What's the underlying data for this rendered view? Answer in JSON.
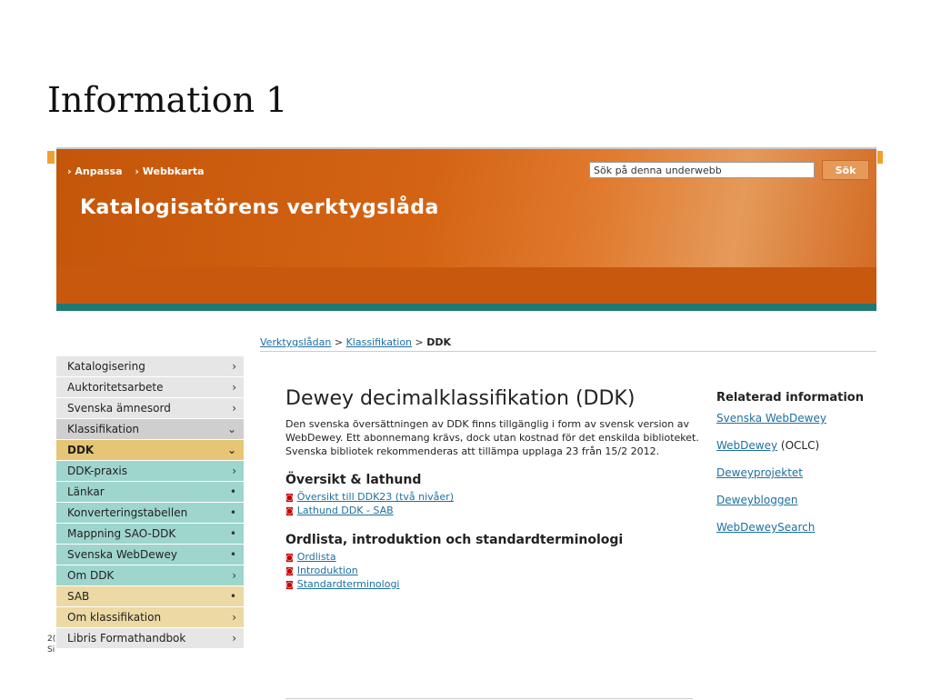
{
  "slide": {
    "title": "Information 1",
    "footer_line1": "2(",
    "footer_line2": "Si"
  },
  "colors": {
    "header_orange": "#d46414",
    "teal_strip": "#1e7a72",
    "sidebar_teal": "#9ed5cc",
    "sidebar_gold": "#e6c676",
    "link_blue": "#1e6fa0"
  },
  "header": {
    "links": [
      "Anpassa",
      "Webbkarta"
    ],
    "site_title": "Katalogisatörens verktygslåda",
    "search": {
      "value": "Sök på denna underwebb",
      "button": "Sök"
    }
  },
  "breadcrumb": {
    "items": [
      "Verktygslådan",
      "Klassifikation"
    ],
    "current": "DDK",
    "separator": ">"
  },
  "sidebar": {
    "items": [
      {
        "label": "Katalogisering",
        "icon": "›"
      },
      {
        "label": "Auktoritetsarbete",
        "icon": "›"
      },
      {
        "label": "Svenska ämnesord",
        "icon": "›"
      },
      {
        "label": "Klassifikation",
        "icon": "⌄"
      },
      {
        "label": "DDK",
        "icon": "⌄"
      },
      {
        "label": "DDK-praxis",
        "icon": "›"
      },
      {
        "label": "Länkar",
        "icon": "•"
      },
      {
        "label": "Konverteringstabellen",
        "icon": "•"
      },
      {
        "label": "Mappning SAO-DDK",
        "icon": "•"
      },
      {
        "label": "Svenska WebDewey",
        "icon": "•"
      },
      {
        "label": "Om DDK",
        "icon": "›"
      },
      {
        "label": "SAB",
        "icon": "•"
      },
      {
        "label": "Om klassifikation",
        "icon": "›"
      },
      {
        "label": "Libris Formathandbok",
        "icon": "›"
      }
    ]
  },
  "main": {
    "heading": "Dewey decimalklassifikation (DDK)",
    "intro": "Den svenska översättningen av DDK finns tillgänglig i form av svensk version av WebDewey. Ett abonnemang krävs, dock utan kostnad för det enskilda biblioteket. Svenska bibliotek rekommenderas att tillämpa upplaga 23 från 15/2 2012.",
    "section1": {
      "heading": "Översikt & lathund",
      "links": [
        "Översikt till DDK23 (två nivåer)",
        "Lathund DDK - SAB"
      ]
    },
    "section2": {
      "heading": "Ordlista, introduktion och standardterminologi",
      "links": [
        "Ordlista",
        "Introduktion",
        "Standardterminologi"
      ]
    }
  },
  "related": {
    "title": "Relaterad information",
    "links": [
      {
        "label": "Svenska WebDewey",
        "extra": ""
      },
      {
        "label": "WebDewey",
        "extra": " (OCLC)"
      },
      {
        "label": "Deweyprojektet",
        "extra": ""
      },
      {
        "label": "Deweybloggen",
        "extra": ""
      },
      {
        "label": "WebDeweySearch",
        "extra": ""
      }
    ]
  }
}
